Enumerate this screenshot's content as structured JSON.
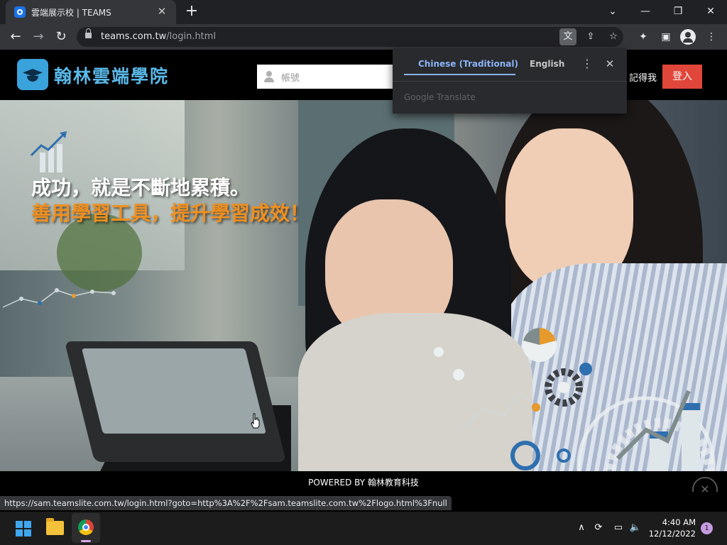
{
  "browser": {
    "tab_title": "雲端展示校 | TEAMS",
    "tab_close": "✕",
    "new_tab": "+",
    "url_host": "teams.com.tw",
    "url_path": "/login.html",
    "status_url": "https://sam.teamslite.com.tw/login.html?goto=http%3A%2F%2Fsam.teamslite.com.tw%2Flogo.html%3Fnull",
    "window_controls": {
      "dropdown": "⌄",
      "minimize": "—",
      "restore": "❐",
      "close": "✕"
    },
    "nav": {
      "back": "←",
      "forward": "→",
      "reload": "↻"
    },
    "icons": {
      "translate": "文",
      "share": "⇪",
      "bookmark": "☆",
      "extensions": "✦",
      "sidepanel": "▣",
      "menu": "⋮"
    }
  },
  "translate_popup": {
    "source_lang": "Chinese (Traditional)",
    "target_lang": "English",
    "menu": "⋮",
    "close": "✕",
    "brand": "Google Translate"
  },
  "site": {
    "logo_text": "翰林雲端學院",
    "account_placeholder": "帳號",
    "remember_me": "記得我",
    "login_button": "登入",
    "headline_1": "成功，就是不斷地累積。",
    "headline_2": "善用學習工具，提升學習成效！",
    "footer": "POWERED BY 翰林教育科技",
    "scroll_top": "✕"
  },
  "taskbar": {
    "time": "4:40 AM",
    "date": "12/12/2022",
    "notification_count": "1",
    "tray": {
      "chevron": "∧",
      "sync": "⟳",
      "network": "▭",
      "volume": "🔈"
    }
  }
}
